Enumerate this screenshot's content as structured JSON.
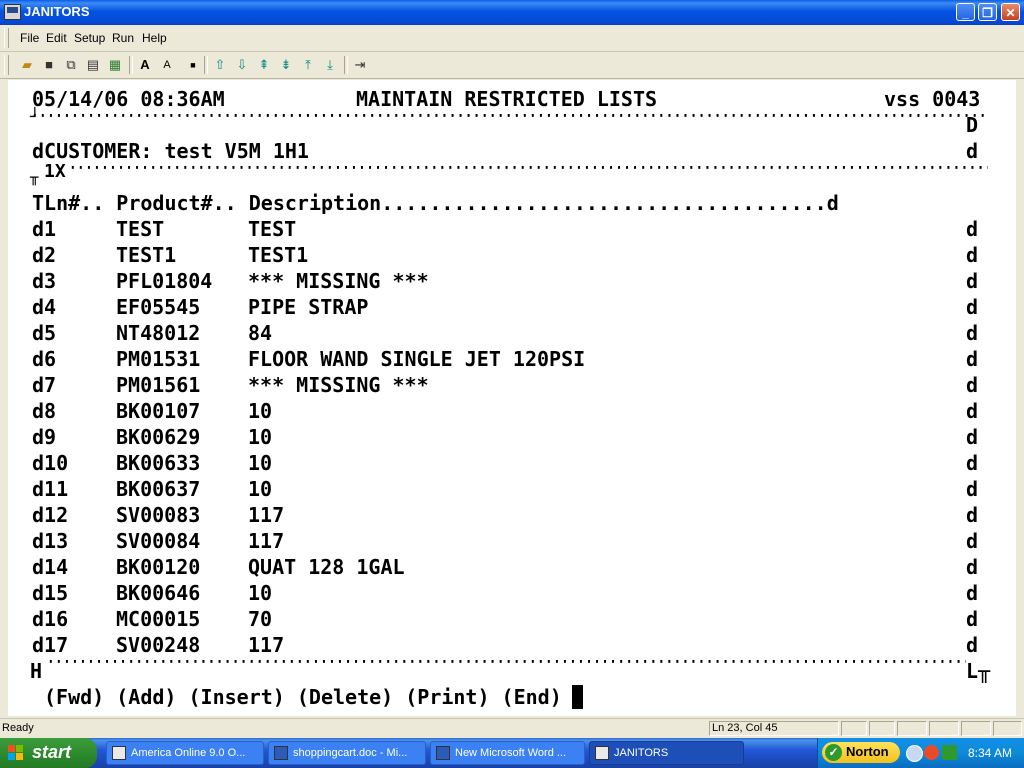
{
  "window": {
    "title": "JANITORS"
  },
  "menu": [
    "File",
    "Edit",
    "Setup",
    "Run",
    "Help"
  ],
  "toolbar_icons": [
    "open-icon",
    "save-icon",
    "copy-icon",
    "paste-icon",
    "print-screen-icon",
    "font-size-increase-icon",
    "font-size-decrease-icon",
    "small-dot-icon",
    "arrow-up-icon",
    "arrow-down-icon",
    "page-up-icon",
    "page-down-icon",
    "top-icon",
    "bottom-icon",
    "send-icon"
  ],
  "terminal": {
    "datetime": "05/14/06 08:36AM",
    "screen_title": "MAINTAIN RESTRICTED LISTS",
    "system": "vss 0043",
    "top_left_glyph": "┘",
    "top_right_glyph": "D",
    "customer_line": "dCUSTOMER: test V5M 1H1",
    "customer_right": "d",
    "section_glyph": "╥",
    "section_label": "1X",
    "header_line": "TLn#.. Product#.. Description.....................................d",
    "rows": [
      {
        "ln": "d1",
        "product": "TEST",
        "description": "TEST",
        "end": "d"
      },
      {
        "ln": "d2",
        "product": "TEST1",
        "description": "TEST1",
        "end": "d"
      },
      {
        "ln": "d3",
        "product": "PFL01804",
        "description": "*** MISSING ***",
        "end": "d"
      },
      {
        "ln": "d4",
        "product": "EF05545",
        "description": "PIPE STRAP",
        "end": "d"
      },
      {
        "ln": "d5",
        "product": "NT48012",
        "description": "84",
        "end": "d"
      },
      {
        "ln": "d6",
        "product": "PM01531",
        "description": "FLOOR WAND SINGLE JET 120PSI",
        "end": "d"
      },
      {
        "ln": "d7",
        "product": "PM01561",
        "description": "*** MISSING ***",
        "end": "d"
      },
      {
        "ln": "d8",
        "product": "BK00107",
        "description": "10",
        "end": "d"
      },
      {
        "ln": "d9",
        "product": "BK00629",
        "description": "10",
        "end": "d"
      },
      {
        "ln": "d10",
        "product": "BK00633",
        "description": "10",
        "end": "d"
      },
      {
        "ln": "d11",
        "product": "BK00637",
        "description": "10",
        "end": "d"
      },
      {
        "ln": "d12",
        "product": "SV00083",
        "description": "117",
        "end": "d"
      },
      {
        "ln": "d13",
        "product": "SV00084",
        "description": "117",
        "end": "d"
      },
      {
        "ln": "d14",
        "product": "BK00120",
        "description": "QUAT 128 1GAL",
        "end": "d"
      },
      {
        "ln": "d15",
        "product": "BK00646",
        "description": "10",
        "end": "d"
      },
      {
        "ln": "d16",
        "product": "MC00015",
        "description": "70",
        "end": "d"
      },
      {
        "ln": "d17",
        "product": "SV00248",
        "description": "117",
        "end": "d"
      }
    ],
    "bottom_left_glyph": "H",
    "bottom_right_glyph": "L╥",
    "commands": "(Fwd) (Add) (Insert) (Delete) (Print) (End)"
  },
  "status": {
    "ready": "Ready",
    "position": "Ln 23, Col 45"
  },
  "taskbar": {
    "start": "start",
    "tasks": [
      {
        "label": "America Online 9.0 O..."
      },
      {
        "label": "shoppingcart.doc - Mi..."
      },
      {
        "label": "New Microsoft Word ..."
      },
      {
        "label": "JANITORS"
      }
    ],
    "norton": "Norton",
    "clock": "8:34 AM"
  }
}
